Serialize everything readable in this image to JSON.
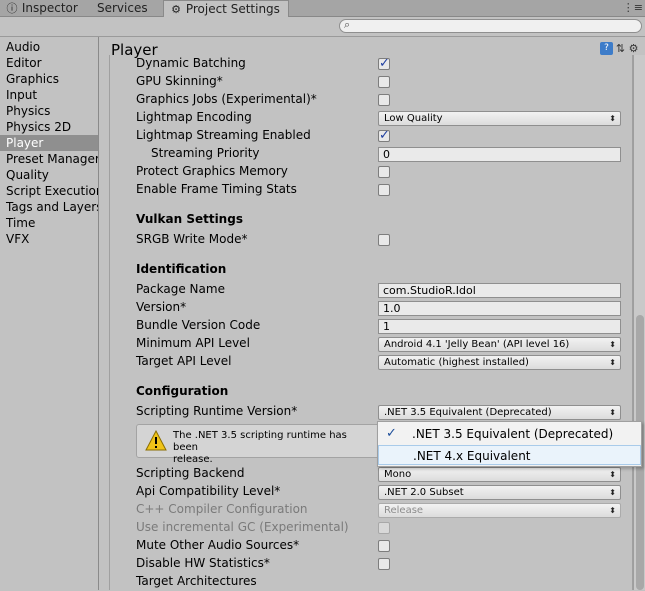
{
  "tabs": [
    {
      "label": "Inspector",
      "icon": "info-icon"
    },
    {
      "label": "Services"
    },
    {
      "label": "Project Settings",
      "icon": "gear-icon",
      "active": true
    }
  ],
  "search": {
    "placeholder": ""
  },
  "nav": {
    "items": [
      "Audio",
      "Editor",
      "Graphics",
      "Input",
      "Physics",
      "Physics 2D",
      "Player",
      "Preset Manager",
      "Quality",
      "Script Execution",
      "Tags and Layers",
      "Time",
      "VFX"
    ],
    "selected": "Player"
  },
  "panel": {
    "title": "Player"
  },
  "rows": {
    "dynamic_batching": {
      "label": "Dynamic Batching",
      "checked": true
    },
    "gpu_skinning": {
      "label": "GPU Skinning*",
      "checked": false
    },
    "graphics_jobs": {
      "label": "Graphics Jobs (Experimental)*",
      "checked": false
    },
    "lightmap_encoding": {
      "label": "Lightmap Encoding",
      "value": "Low Quality"
    },
    "lightmap_streaming": {
      "label": "Lightmap Streaming Enabled",
      "checked": true
    },
    "streaming_priority": {
      "label": "Streaming Priority",
      "value": "0"
    },
    "protect_graphics_memory": {
      "label": "Protect Graphics Memory",
      "checked": false
    },
    "frame_timing": {
      "label": "Enable Frame Timing Stats",
      "checked": false
    },
    "vulkan_header": {
      "label": "Vulkan Settings"
    },
    "srgb_write": {
      "label": "SRGB Write Mode*",
      "checked": false
    },
    "identification_header": {
      "label": "Identification"
    },
    "package_name": {
      "label": "Package Name",
      "value": "com.StudioR.Idol"
    },
    "version": {
      "label": "Version*",
      "value": "1.0"
    },
    "bundle_version": {
      "label": "Bundle Version Code",
      "value": "1"
    },
    "min_api": {
      "label": "Minimum API Level",
      "value": "Android 4.1 'Jelly Bean' (API level 16)"
    },
    "target_api": {
      "label": "Target API Level",
      "value": "Automatic (highest installed)"
    },
    "configuration_header": {
      "label": "Configuration"
    },
    "scripting_runtime": {
      "label": "Scripting Runtime Version*",
      "value": ".NET 3.5 Equivalent (Deprecated)"
    },
    "scripting_backend": {
      "label": "Scripting Backend",
      "value": "Mono"
    },
    "api_compat": {
      "label": "Api Compatibility Level*",
      "value": ".NET 2.0 Subset"
    },
    "cpp_compiler": {
      "label": "C++ Compiler Configuration",
      "value": "Release"
    },
    "incremental_gc": {
      "label": "Use incremental GC (Experimental)",
      "checked": false
    },
    "mute_audio": {
      "label": "Mute Other Audio Sources*",
      "checked": false
    },
    "disable_hw_stats": {
      "label": "Disable HW Statistics*",
      "checked": false
    },
    "target_arch": {
      "label": "Target Architectures"
    }
  },
  "warning": {
    "text_line1": "The .NET 3.5 scripting runtime has been",
    "text_line2": "release."
  },
  "popup": {
    "options": [
      ".NET 3.5 Equivalent (Deprecated)",
      ".NET 4.x Equivalent"
    ],
    "checked_index": 0,
    "highlighted_index": 1
  },
  "colors": {
    "selected_nav": "#8f8f8f",
    "checkmark": "#1f3fa0",
    "warning": "#f0c419",
    "popup_highlight": "#eaf3fb"
  }
}
